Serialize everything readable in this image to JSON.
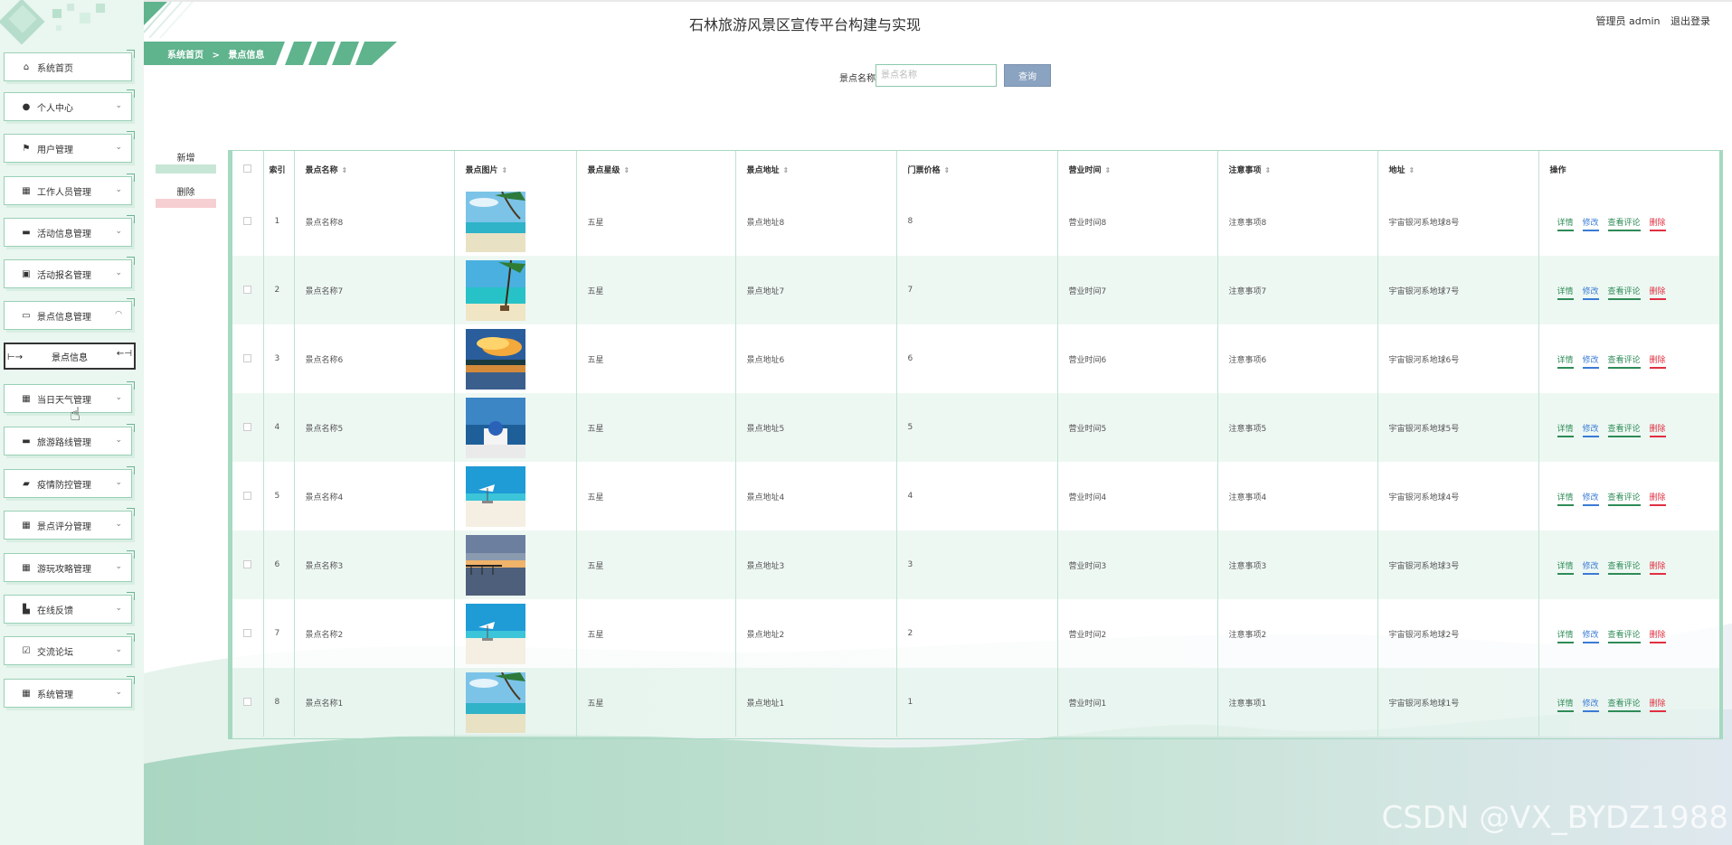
{
  "header": {
    "title": "石林旅游风景区宣传平台构建与实现",
    "user_label": "管理员 admin",
    "logout_label": "退出登录"
  },
  "breadcrumb": {
    "home": "系统首页",
    "separator": ">",
    "current": "景点信息"
  },
  "sidebar": {
    "items": [
      {
        "label": "系统首页",
        "icon": "home-icon"
      },
      {
        "label": "个人中心",
        "icon": "user-icon"
      },
      {
        "label": "用户管理",
        "icon": "flag-icon"
      },
      {
        "label": "工作人员管理",
        "icon": "grid-icon"
      },
      {
        "label": "活动信息管理",
        "icon": "chat-icon"
      },
      {
        "label": "活动报名管理",
        "icon": "chart-icon"
      },
      {
        "label": "景点信息管理",
        "icon": "monitor-icon"
      },
      {
        "label": "当日天气管理",
        "icon": "grid-icon"
      },
      {
        "label": "旅游路线管理",
        "icon": "chat-icon"
      },
      {
        "label": "疫情防控管理",
        "icon": "briefcase-icon"
      },
      {
        "label": "景点评分管理",
        "icon": "grid-icon"
      },
      {
        "label": "游玩攻略管理",
        "icon": "grid-icon"
      },
      {
        "label": "在线反馈",
        "icon": "cart-icon"
      },
      {
        "label": "交流论坛",
        "icon": "check-icon"
      },
      {
        "label": "系统管理",
        "icon": "grid-icon"
      }
    ],
    "active_submenu": "景点信息"
  },
  "search": {
    "label": "景点名称",
    "placeholder": "景点名称",
    "button": "查询"
  },
  "actions": {
    "add": "新增",
    "delete": "删除"
  },
  "table": {
    "columns": [
      "索引",
      "景点名称",
      "景点图片",
      "景点星级",
      "景点地址",
      "门票价格",
      "营业时间",
      "注意事项",
      "地址",
      "操作"
    ],
    "ops": {
      "detail": "详情",
      "edit": "修改",
      "review": "查看评论",
      "delete": "删除"
    },
    "rows": [
      {
        "index": "1",
        "name": "景点名称8",
        "image": "beach-palm",
        "stars": "五星",
        "address": "景点地址8",
        "price": "8",
        "hours": "营业时间8",
        "notes": "注意事项8",
        "location": "宇宙银河系地球8号"
      },
      {
        "index": "2",
        "name": "景点名称7",
        "image": "tropical-shore",
        "stars": "五星",
        "address": "景点地址7",
        "price": "7",
        "hours": "营业时间7",
        "notes": "注意事项7",
        "location": "宇宙银河系地球7号"
      },
      {
        "index": "3",
        "name": "景点名称6",
        "image": "sunset-lake",
        "stars": "五星",
        "address": "景点地址6",
        "price": "6",
        "hours": "营业时间6",
        "notes": "注意事项6",
        "location": "宇宙银河系地球6号"
      },
      {
        "index": "4",
        "name": "景点名称5",
        "image": "santorini",
        "stars": "五星",
        "address": "景点地址5",
        "price": "5",
        "hours": "营业时间5",
        "notes": "注意事项5",
        "location": "宇宙银河系地球5号"
      },
      {
        "index": "5",
        "name": "景点名称4",
        "image": "white-beach",
        "stars": "五星",
        "address": "景点地址4",
        "price": "4",
        "hours": "营业时间4",
        "notes": "注意事项4",
        "location": "宇宙银河系地球4号"
      },
      {
        "index": "6",
        "name": "景点名称3",
        "image": "pier-sunset",
        "stars": "五星",
        "address": "景点地址3",
        "price": "3",
        "hours": "营业时间3",
        "notes": "注意事项3",
        "location": "宇宙银河系地球3号"
      },
      {
        "index": "7",
        "name": "景点名称2",
        "image": "white-beach",
        "stars": "五星",
        "address": "景点地址2",
        "price": "2",
        "hours": "营业时间2",
        "notes": "注意事项2",
        "location": "宇宙银河系地球2号"
      },
      {
        "index": "8",
        "name": "景点名称1",
        "image": "beach-palm",
        "stars": "五星",
        "address": "景点地址1",
        "price": "1",
        "hours": "营业时间1",
        "notes": "注意事项1",
        "location": "宇宙银河系地球1号"
      }
    ]
  },
  "watermark": "CSDN @VX_BYDZ1988",
  "colors": {
    "accent": "#5fb38d",
    "sidebar_bg": "#eaf6f0",
    "edit": "#3a7bd5",
    "delete": "#e03040",
    "detail": "#2e8b57"
  }
}
